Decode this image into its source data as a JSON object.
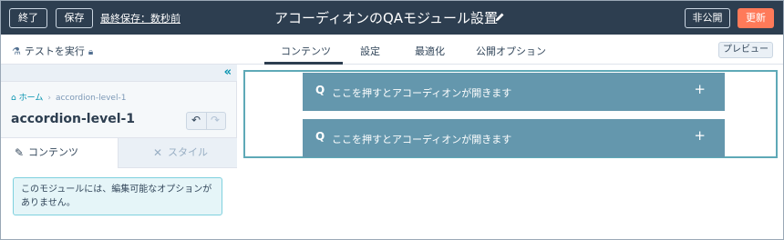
{
  "topbar": {
    "exit_label": "終了",
    "save_label": "保存",
    "last_saved": "最終保存：数秒前",
    "page_title": "アコーディオンのQAモジュール設置",
    "unpublish_label": "非公開",
    "update_label": "更新",
    "update_color": "#ff7a59",
    "background_color": "#2d3e50"
  },
  "subbar": {
    "test_run": "テストを実行",
    "tabs": [
      {
        "label": "コンテンツ",
        "active": true
      },
      {
        "label": "設定",
        "active": false
      },
      {
        "label": "最適化",
        "active": false
      },
      {
        "label": "公開オプション",
        "active": false
      }
    ],
    "preview_label": "プレビュー"
  },
  "left_panel": {
    "collapse_icon": "«",
    "breadcrumb": {
      "home": "ホーム",
      "separator": "›",
      "current": "accordion-level-1"
    },
    "module_title": "accordion-level-1",
    "undo_icon": "↶",
    "redo_icon": "↷",
    "tabs": [
      {
        "label": "コンテンツ",
        "icon": "pencil-icon",
        "active": true
      },
      {
        "label": "スタイル",
        "icon": "tools-icon",
        "active": false
      }
    ],
    "info_message": "このモジュールには、編集可能なオプションがありません。"
  },
  "preview": {
    "accordion_items": [
      {
        "q": "Q",
        "text": "ここを押すとアコーディオンが開きます",
        "toggle": "+"
      },
      {
        "q": "Q",
        "text": "ここを押すとアコーディオンが開きます",
        "toggle": "+"
      }
    ],
    "accordion_color": "#6497ad",
    "outline_color": "#5ea9b7"
  }
}
